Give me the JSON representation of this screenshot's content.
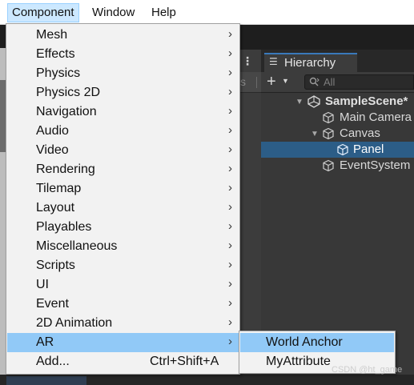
{
  "menubar": {
    "items": [
      {
        "label": "Component",
        "active": true
      },
      {
        "label": "Window",
        "active": false
      },
      {
        "label": "Help",
        "active": false
      }
    ]
  },
  "component_menu": {
    "items": [
      {
        "label": "Mesh",
        "submenu": true
      },
      {
        "label": "Effects",
        "submenu": true
      },
      {
        "label": "Physics",
        "submenu": true
      },
      {
        "label": "Physics 2D",
        "submenu": true
      },
      {
        "label": "Navigation",
        "submenu": true
      },
      {
        "label": "Audio",
        "submenu": true
      },
      {
        "label": "Video",
        "submenu": true
      },
      {
        "label": "Rendering",
        "submenu": true
      },
      {
        "label": "Tilemap",
        "submenu": true
      },
      {
        "label": "Layout",
        "submenu": true
      },
      {
        "label": "Playables",
        "submenu": true
      },
      {
        "label": "Miscellaneous",
        "submenu": true
      },
      {
        "label": "Scripts",
        "submenu": true
      },
      {
        "label": "UI",
        "submenu": true
      },
      {
        "label": "Event",
        "submenu": true
      },
      {
        "label": "2D Animation",
        "submenu": true
      },
      {
        "label": "AR",
        "submenu": true,
        "highlighted": true
      },
      {
        "label": "Add...",
        "shortcut": "Ctrl+Shift+A"
      }
    ],
    "arrow_glyph": "›"
  },
  "ar_submenu": {
    "items": [
      {
        "label": "World Anchor",
        "highlighted": true
      },
      {
        "label": "MyAttribute"
      }
    ]
  },
  "scene_toolbar": {
    "partial_text": "s",
    "menu_glyph": "⋮"
  },
  "hierarchy": {
    "tab_label": "Hierarchy",
    "tab_icon": "list-icon",
    "add_glyph": "+",
    "search_placeholder": "All",
    "tree": [
      {
        "label": "SampleScene*",
        "bold": true,
        "expanded": true,
        "icon": "unity-scene-icon"
      },
      {
        "label": "Main Camera",
        "icon": "cube-icon"
      },
      {
        "label": "Canvas",
        "expanded": true,
        "icon": "cube-icon"
      },
      {
        "label": "Panel",
        "selected": true,
        "icon": "cube-icon"
      },
      {
        "label": "EventSystem",
        "icon": "cube-icon"
      }
    ]
  },
  "watermark": "CSDN @ht_game",
  "colors": {
    "menu_highlight": "#91c9f7",
    "menubar_active": "#cce8ff",
    "hierarchy_selected": "#2c5d87",
    "editor_dark": "#383838"
  }
}
